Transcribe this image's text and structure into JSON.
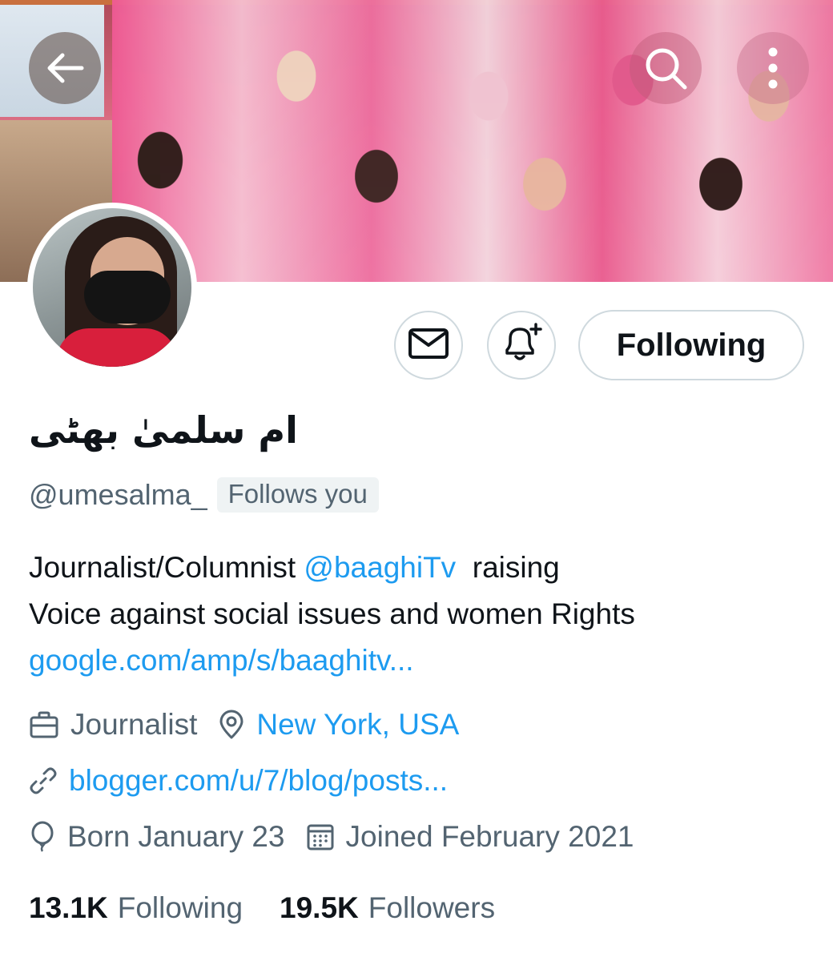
{
  "profile": {
    "display_name": "ام سلمیٰ بھٹی",
    "handle": "@umesalma_",
    "follows_you": "Follows you",
    "bio": {
      "text_before_mention": "Journalist/Columnist ",
      "mention": "@baaghiTv",
      "text_after_mention": "  raising",
      "line2": "Voice against social issues and women Rights",
      "link": "google.com/amp/s/baaghitv..."
    },
    "profession": "Journalist",
    "location": "New York, USA",
    "website": "blogger.com/u/7/blog/posts...",
    "birthday": "Born January 23",
    "joined": "Joined February 2021"
  },
  "actions": {
    "following_label": "Following"
  },
  "stats": {
    "following_count": "13.1K",
    "following_label": "Following",
    "followers_count": "19.5K",
    "followers_label": "Followers"
  },
  "icons": {
    "back": "back-arrow-icon",
    "search": "search-icon",
    "more": "more-vertical-icon",
    "message": "mail-icon",
    "notify": "bell-plus-icon",
    "profession": "briefcase-icon",
    "location": "location-pin-icon",
    "website": "link-icon",
    "birthday": "balloon-icon",
    "joined": "calendar-icon"
  },
  "colors": {
    "accent": "#1d9bf0",
    "text_primary": "#0f1419",
    "text_secondary": "#536471",
    "border": "#cfd9de",
    "badge_bg": "#eff3f4"
  }
}
